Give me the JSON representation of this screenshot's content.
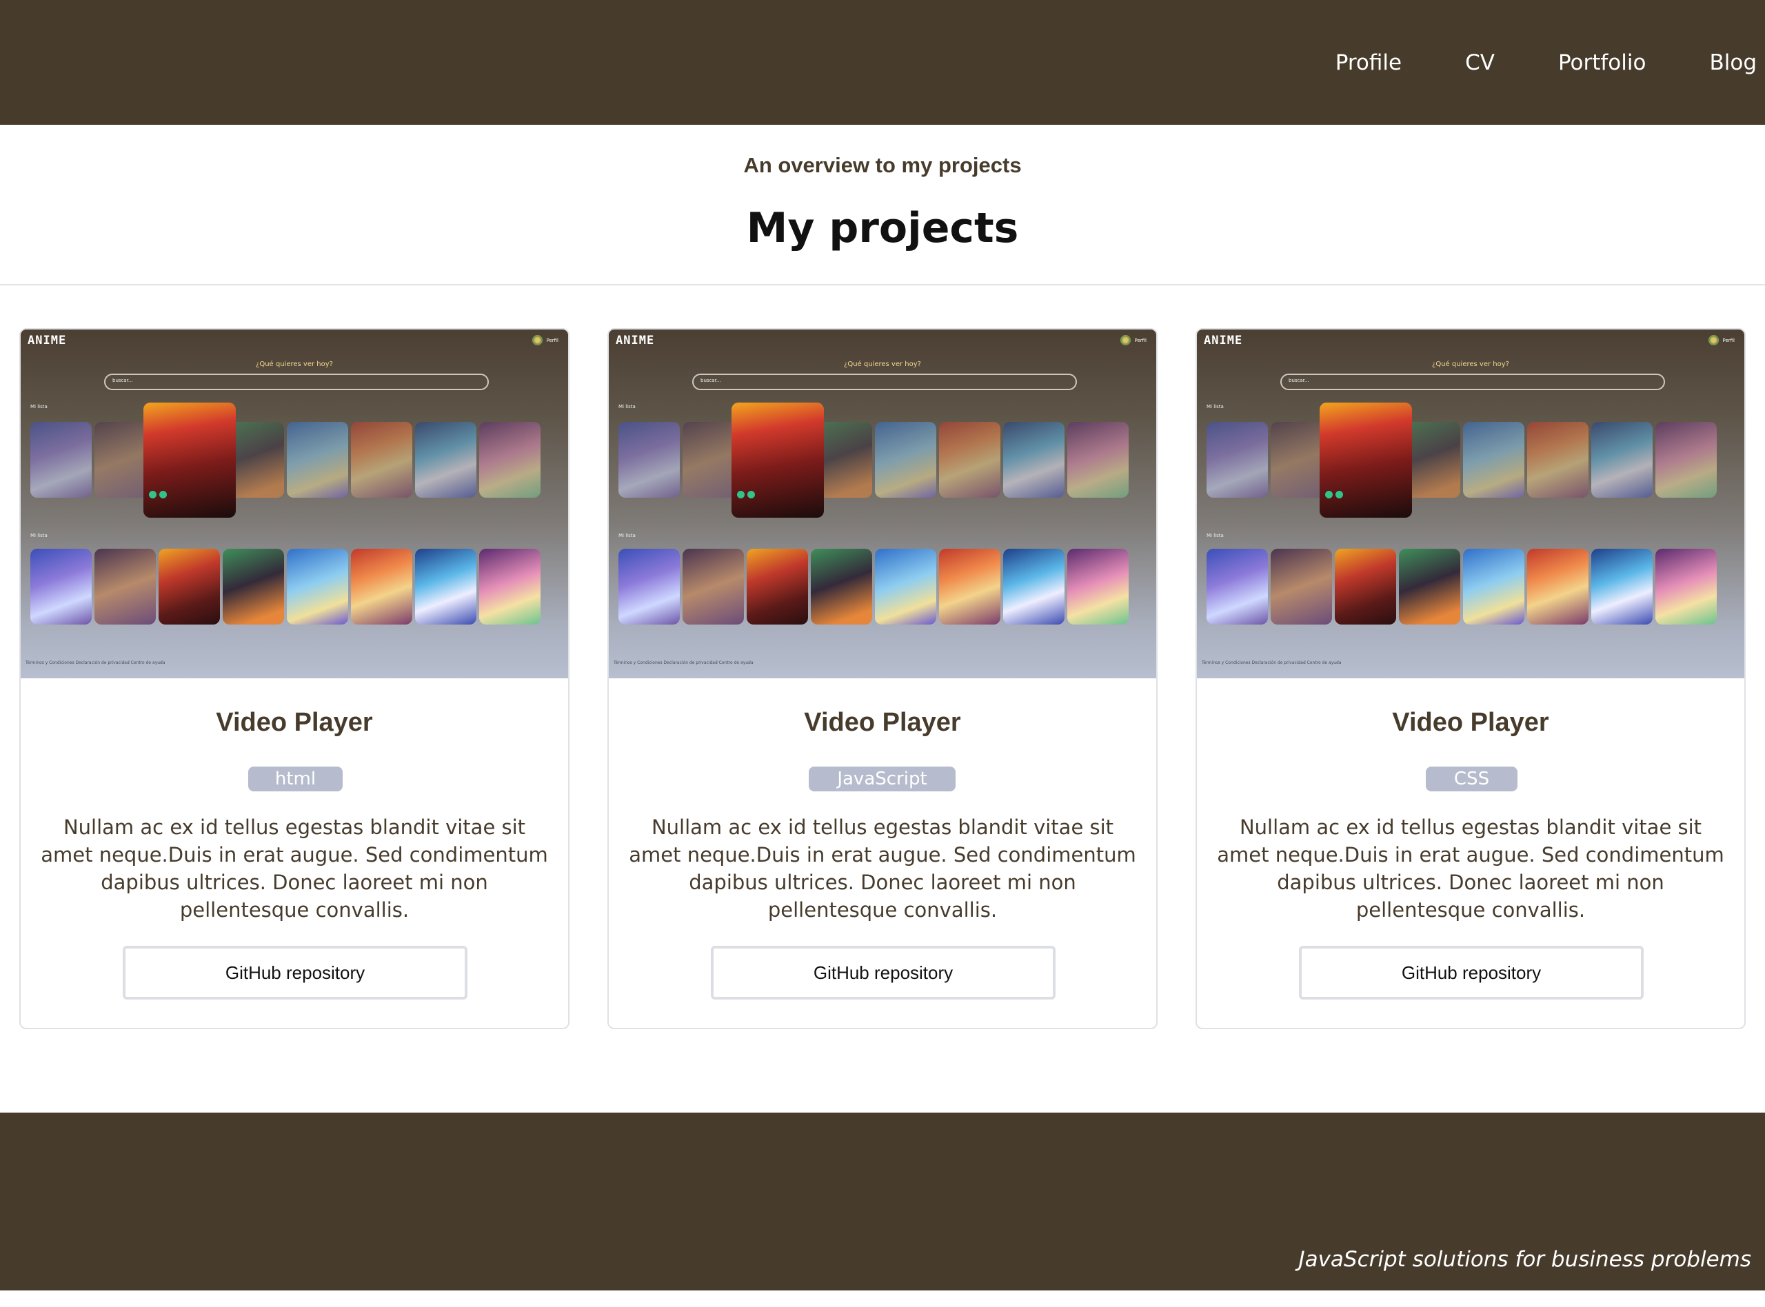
{
  "nav": {
    "items": [
      {
        "label": "Profile"
      },
      {
        "label": "CV"
      },
      {
        "label": "Portfolio"
      },
      {
        "label": "Blog"
      }
    ]
  },
  "header": {
    "overview": "An overview to my projects",
    "title": "My projects"
  },
  "thumbnail": {
    "logo": "ANIME",
    "profile_label": "Perfil",
    "question": "¿Qué quieres ver hoy?",
    "search_placeholder": "buscar...",
    "section_label": "Mi lista",
    "footer_links": "Términos y Condiciones    Declaración de privacidad    Centro de ayuda"
  },
  "projects": [
    {
      "title": "Video Player",
      "tag": "html",
      "description": "Nullam ac ex id tellus egestas blandit vitae sit amet neque.Duis in erat augue. Sed condimentum dapibus ultrices. Donec laoreet mi non pellentesque convallis.",
      "button_label": "GitHub repository"
    },
    {
      "title": "Video Player",
      "tag": "JavaScript",
      "description": "Nullam ac ex id tellus egestas blandit vitae sit amet neque.Duis in erat augue. Sed condimentum dapibus ultrices. Donec laoreet mi non pellentesque convallis.",
      "button_label": "GitHub repository"
    },
    {
      "title": "Video Player",
      "tag": "CSS",
      "description": "Nullam ac ex id tellus egestas blandit vitae sit amet neque.Duis in erat augue. Sed condimentum dapibus ultrices. Donec laoreet mi non pellentesque convallis.",
      "button_label": "GitHub repository"
    }
  ],
  "footer": {
    "slogan": "JavaScript solutions for business problems"
  },
  "colors": {
    "brand_dark": "#473b2c",
    "tag_bg": "#b6bccd",
    "border": "#dfe1e6"
  }
}
